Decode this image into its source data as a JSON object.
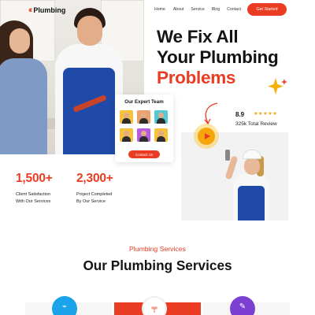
{
  "brand": {
    "name": "Plumbing",
    "mark": "‹‹",
    "accent": "#ea3c22"
  },
  "nav": {
    "items": [
      {
        "label": "Home"
      },
      {
        "label": "About"
      },
      {
        "label": "Service"
      },
      {
        "label": "Blog"
      },
      {
        "label": "Contact"
      }
    ],
    "cta": "Get Started"
  },
  "hero": {
    "line1": "We Fix All",
    "line2": "Your Plumbing",
    "line3": "Problems"
  },
  "expert_team": {
    "title": "Our Expert Team",
    "button": "Contact Us",
    "avatar_colors": [
      "#f6c23a",
      "#eca06b",
      "#56c7d4",
      "#f6c23a",
      "#b95ae0",
      "#f6c23a"
    ]
  },
  "rating": {
    "score": "8.9",
    "stars": "★★★★★",
    "label": "325k Total Review"
  },
  "stats": [
    {
      "value": "1,500+",
      "label_line1": "Client Satisfaction",
      "label_line2": "With Our Services"
    },
    {
      "value": "2,300+",
      "label_line1": "Project Completed",
      "label_line2": "By Our Service"
    }
  ],
  "services": {
    "subtitle": "Plumbing Services",
    "title": "Our Plumbing Services",
    "icon_colors": [
      "#1aa3e8",
      "#ea3c22",
      "#7b3fd1"
    ]
  }
}
